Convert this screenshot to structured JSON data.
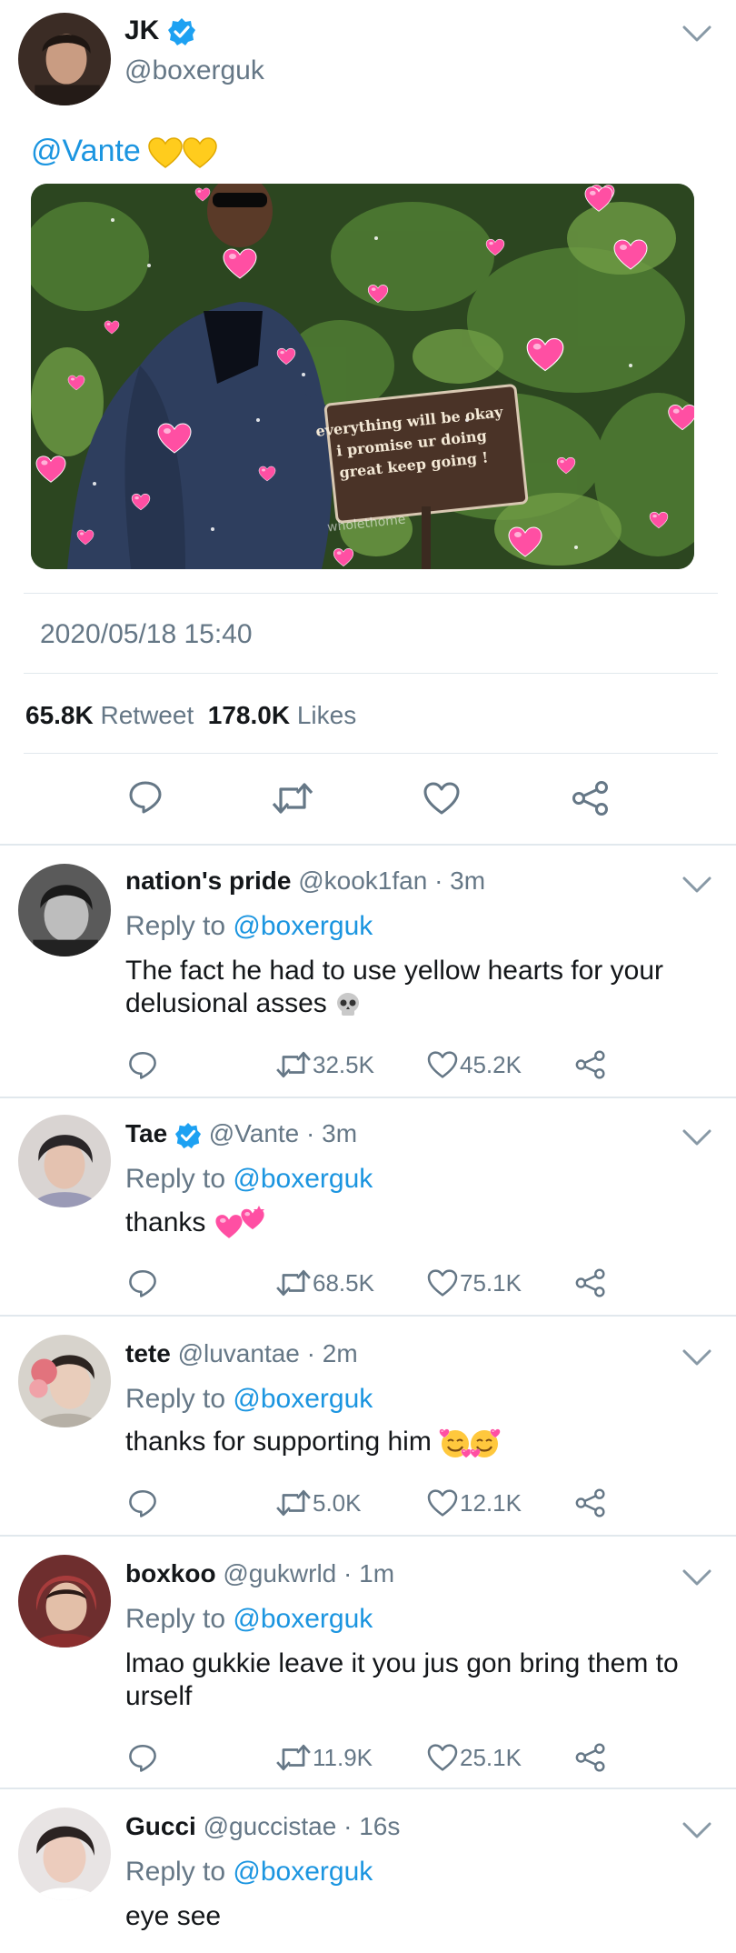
{
  "main_tweet": {
    "name": "JK",
    "handle": "@boxerguk",
    "text": "@Vante",
    "sign_text": "everything will be okay i promise ur doing great keep going !",
    "watermark": "wholethome",
    "timestamp": "2020/05/18 15:40",
    "retweets": "65.8K",
    "retweet_label": "Retweet",
    "likes": "178.0K",
    "likes_label": "Likes"
  },
  "replies": [
    {
      "name": "nation's pride",
      "handle": "@kook1fan · 3m",
      "reply_prefix": "Reply to",
      "reply_user": "@boxerguk",
      "text": "The fact he had to use yellow hearts for your delusional asses",
      "retweets": "32.5K",
      "likes": "45.2K"
    },
    {
      "name": "Tae",
      "handle": "@Vante · 3m",
      "reply_prefix": "Reply to",
      "reply_user": "@boxerguk",
      "text": "thanks",
      "retweets": "68.5K",
      "likes": "75.1K"
    },
    {
      "name": "tete",
      "handle": "@luvantae · 2m",
      "reply_prefix": "Reply to",
      "reply_user": "@boxerguk",
      "text": "thanks for supporting him",
      "retweets": "5.0K",
      "likes": "12.1K"
    },
    {
      "name": "boxkoo",
      "handle": "@gukwrld · 1m",
      "reply_prefix": "Reply to",
      "reply_user": "@boxerguk",
      "text": "lmao gukkie leave it you jus gon bring them to urself",
      "retweets": "11.9K",
      "likes": "25.1K"
    },
    {
      "name": "Gucci",
      "handle": "@guccistae · 16s",
      "reply_prefix": "Reply to",
      "reply_user": "@boxerguk",
      "text": "eye see"
    }
  ],
  "colors": {
    "link": "#1b95e0",
    "muted": "#657786",
    "verified": "#1da1f2",
    "divider": "#e1e8ed"
  },
  "icons": [
    "chevron-down-icon",
    "verified-badge-icon",
    "reply-icon",
    "retweet-icon",
    "like-icon",
    "share-icon",
    "skull-emoji",
    "two-hearts-emoji",
    "smiling-hearts-emoji",
    "yellow-heart-emoji"
  ]
}
